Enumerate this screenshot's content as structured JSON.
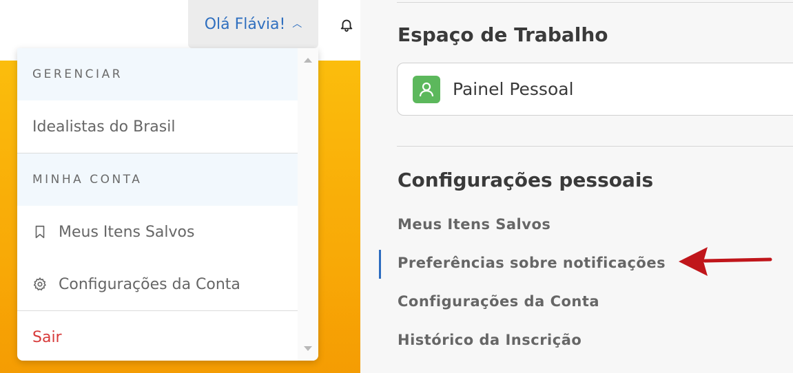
{
  "header": {
    "greeting": "Olá Flávia!",
    "chevron_icon": "chevron-up-icon",
    "bell_icon": "bell-icon"
  },
  "dropdown": {
    "manage_heading": "GERENCIAR",
    "org_item": "Idealistas do Brasil",
    "account_heading": "MINHA CONTA",
    "saved_items": "Meus Itens Salvos",
    "account_settings": "Configurações da Conta",
    "logout": "Sair"
  },
  "workspace": {
    "title": "Espaço de Trabalho",
    "selected": "Painel Pessoal"
  },
  "settings": {
    "title": "Configurações pessoais",
    "links": [
      "Meus Itens Salvos",
      "Preferências sobre notificações",
      "Configurações da Conta",
      "Histórico da Inscrição"
    ],
    "active_index": 1
  },
  "colors": {
    "accent_blue": "#2f6fbf",
    "logout_red": "#d73a3a",
    "hero_yellow": "#fbbd0c",
    "avatar_green": "#5cb85c",
    "arrow_red": "#c0161b"
  }
}
